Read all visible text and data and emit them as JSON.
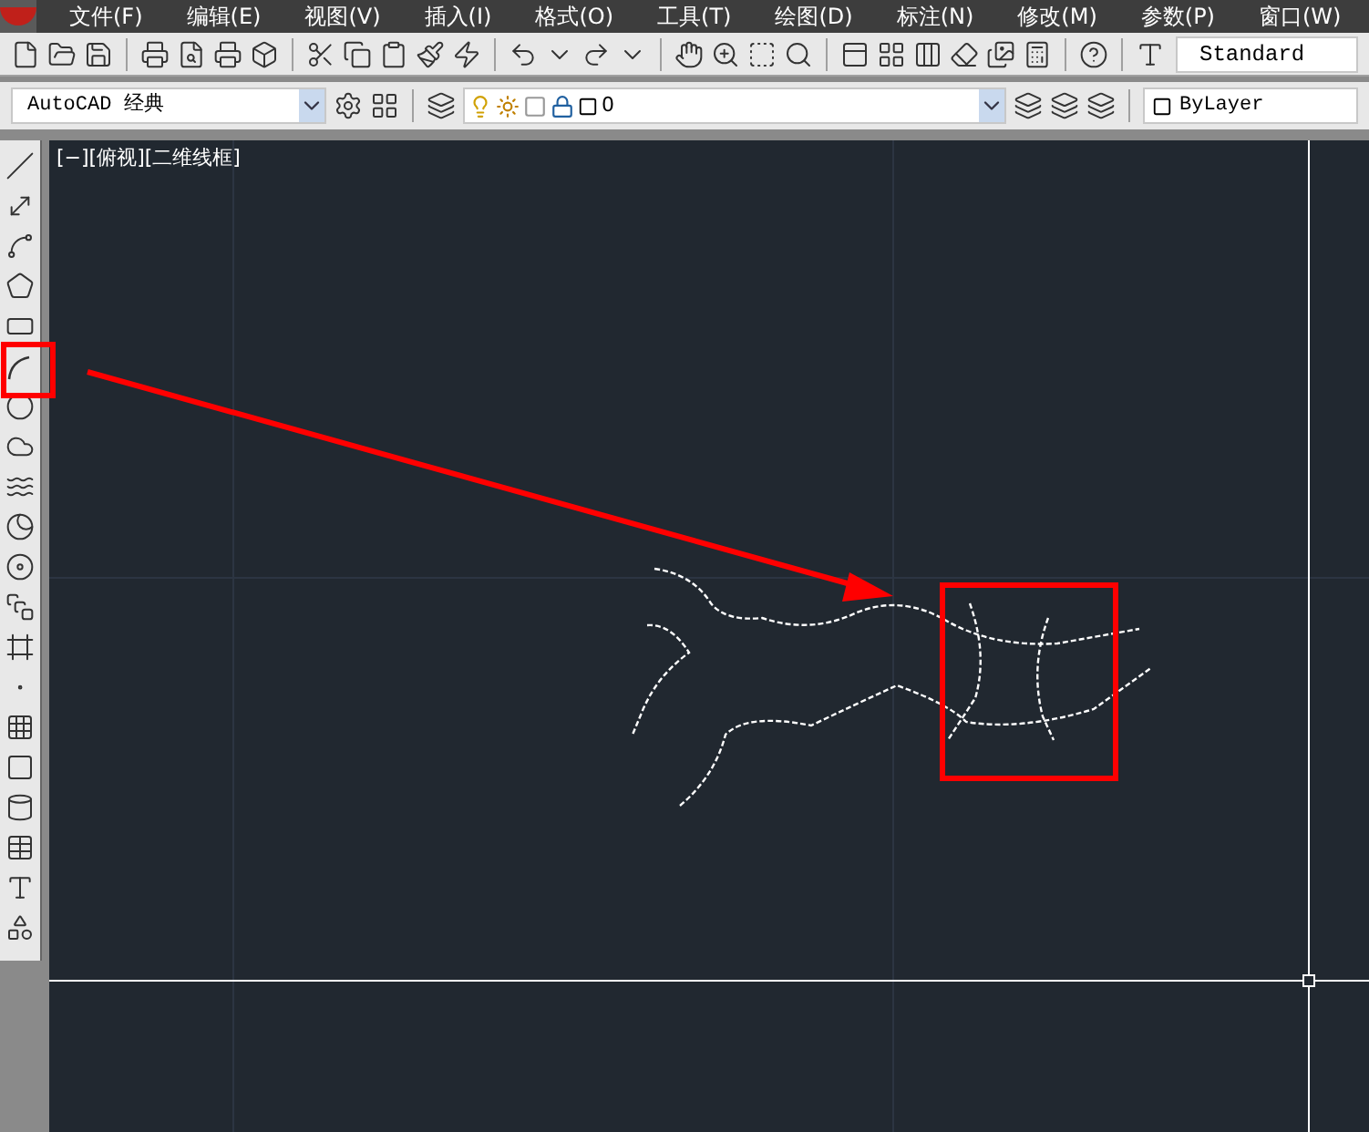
{
  "menu_bar": {
    "items": [
      "文件(F)",
      "编辑(E)",
      "视图(V)",
      "插入(I)",
      "格式(O)",
      "工具(T)",
      "绘图(D)",
      "标注(N)",
      "修改(M)",
      "参数(P)",
      "窗口(W)"
    ]
  },
  "standard_toolbar": {
    "text_style": "Standard"
  },
  "workspace_toolbar": {
    "workspace": "AutoCAD 经典",
    "layer": "0",
    "color_control": "ByLayer"
  },
  "viewport": {
    "label": "[−][俯视][二维线框]"
  }
}
